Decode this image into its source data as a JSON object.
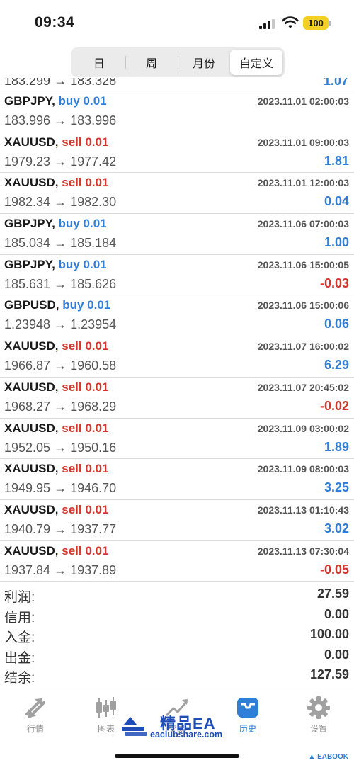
{
  "status_bar": {
    "time": "09:34",
    "battery": "100"
  },
  "period_tabs": [
    {
      "label": "日",
      "active": false
    },
    {
      "label": "周",
      "active": false
    },
    {
      "label": "月份",
      "active": false
    },
    {
      "label": "自定义",
      "active": true
    }
  ],
  "partial_row": {
    "price": "183.299 → 183.328",
    "profit": "1.07"
  },
  "trades": [
    {
      "symbol": "GBPJPY,",
      "side": "buy",
      "volume": "0.01",
      "time": "2023.11.01 02:00:03",
      "price": "183.996 → 183.996",
      "profit": ""
    },
    {
      "symbol": "XAUUSD,",
      "side": "sell",
      "volume": "0.01",
      "time": "2023.11.01 09:00:03",
      "price": "1979.23 → 1977.42",
      "profit": "1.81"
    },
    {
      "symbol": "XAUUSD,",
      "side": "sell",
      "volume": "0.01",
      "time": "2023.11.01 12:00:03",
      "price": "1982.34 → 1982.30",
      "profit": "0.04"
    },
    {
      "symbol": "GBPJPY,",
      "side": "buy",
      "volume": "0.01",
      "time": "2023.11.06 07:00:03",
      "price": "185.034 → 185.184",
      "profit": "1.00"
    },
    {
      "symbol": "GBPJPY,",
      "side": "buy",
      "volume": "0.01",
      "time": "2023.11.06 15:00:05",
      "price": "185.631 → 185.626",
      "profit": "-0.03"
    },
    {
      "symbol": "GBPUSD,",
      "side": "buy",
      "volume": "0.01",
      "time": "2023.11.06 15:00:06",
      "price": "1.23948 → 1.23954",
      "profit": "0.06"
    },
    {
      "symbol": "XAUUSD,",
      "side": "sell",
      "volume": "0.01",
      "time": "2023.11.07 16:00:02",
      "price": "1966.87 → 1960.58",
      "profit": "6.29"
    },
    {
      "symbol": "XAUUSD,",
      "side": "sell",
      "volume": "0.01",
      "time": "2023.11.07 20:45:02",
      "price": "1968.27 → 1968.29",
      "profit": "-0.02"
    },
    {
      "symbol": "XAUUSD,",
      "side": "sell",
      "volume": "0.01",
      "time": "2023.11.09 03:00:02",
      "price": "1952.05 → 1950.16",
      "profit": "1.89"
    },
    {
      "symbol": "XAUUSD,",
      "side": "sell",
      "volume": "0.01",
      "time": "2023.11.09 08:00:03",
      "price": "1949.95 → 1946.70",
      "profit": "3.25"
    },
    {
      "symbol": "XAUUSD,",
      "side": "sell",
      "volume": "0.01",
      "time": "2023.11.13 01:10:43",
      "price": "1940.79 → 1937.77",
      "profit": "3.02"
    },
    {
      "symbol": "XAUUSD,",
      "side": "sell",
      "volume": "0.01",
      "time": "2023.11.13 07:30:04",
      "price": "1937.84 → 1937.89",
      "profit": "-0.05"
    }
  ],
  "summary": [
    {
      "label": "利润:",
      "value": "27.59"
    },
    {
      "label": "信用:",
      "value": "0.00"
    },
    {
      "label": "入金:",
      "value": "100.00"
    },
    {
      "label": "出金:",
      "value": "0.00"
    },
    {
      "label": "结余:",
      "value": "127.59"
    }
  ],
  "tab_bar": [
    {
      "label": "行情",
      "icon": "quotes-icon",
      "active": false
    },
    {
      "label": "图表",
      "icon": "candlestick-icon",
      "active": false
    },
    {
      "label": "交易",
      "icon": "trade-icon",
      "active": false
    },
    {
      "label": "历史",
      "icon": "history-inbox-icon",
      "active": true
    },
    {
      "label": "设置",
      "icon": "gear-icon",
      "active": false
    }
  ],
  "watermark": {
    "title": "精品EA",
    "url": "eaclubshare.com"
  },
  "corner_brand": "EABOOK",
  "colors": {
    "buy": "#2f7ed8",
    "sell": "#d2372d",
    "profit_positive": "#2f7ed8",
    "profit_negative": "#d2372d",
    "active_tab": "#2f7ed8"
  }
}
